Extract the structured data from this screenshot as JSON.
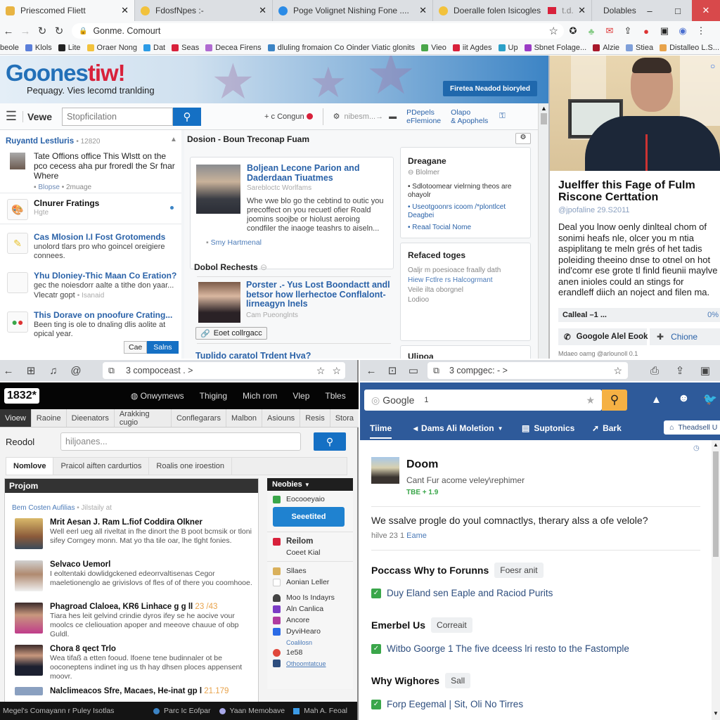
{
  "browser": {
    "tabs": [
      {
        "label": "Priescomed Fliett",
        "favicon_color": "#e8b443",
        "active": true
      },
      {
        "label": "FdosfNpes :-",
        "favicon_color": "#f2c23c",
        "active": false
      },
      {
        "label": "Poge Volignet Nishing Fone ....",
        "favicon_color": "#2b8be6",
        "active": false
      },
      {
        "label": "Doeralle folen Isicogles",
        "favicon_color": "#f2c23c",
        "extra": "t.d.",
        "active": false
      },
      {
        "label": "Dolables",
        "favicon_color": "#2b8be6",
        "active": false
      }
    ],
    "address": "Gonme. Comourt",
    "bookmarks": [
      {
        "label": "beole",
        "color": ""
      },
      {
        "label": "Klols",
        "color": "#5b7fd9"
      },
      {
        "label": "Lite",
        "color": "#222222"
      },
      {
        "label": "Oraer Nong",
        "color": "#f2c23c"
      },
      {
        "label": "Dat",
        "color": "#2b9be6"
      },
      {
        "label": "Seas",
        "color": "#d8213b"
      },
      {
        "label": "Decea Firens",
        "color": "#b06bd1"
      },
      {
        "label": "dluling fromaion Co Oinder Viatic glonits",
        "color": "#3c84c5"
      },
      {
        "label": "Vieo",
        "color": "#4aa64a"
      },
      {
        "label": "iit Agdes",
        "color": "#d8213b"
      },
      {
        "label": "Up",
        "color": "#2ba0c8"
      },
      {
        "label": "Sbnet Folage...",
        "color": "#9b3cc5"
      },
      {
        "label": "Alzie",
        "color": "#a8182b"
      },
      {
        "label": "Stiea",
        "color": "#7f9fd9"
      },
      {
        "label": "Distalleo L.S...",
        "color": "#e8a34b"
      }
    ],
    "window_controls": {
      "minimize": "–",
      "maximize": "□",
      "close": "✕"
    }
  },
  "site1": {
    "logo_part1": "Goones",
    "logo_part2": "tiw!",
    "tagline": "Pequagy. Vies lecomd tranlding",
    "banner_button": "Firetea Neadod bioryled",
    "view_label": "Vewe",
    "search_placeholder": "Stopficilation",
    "toolbar": {
      "add_label": "+ c Congun",
      "step_label": "nibesm...→",
      "link1a": "PDepels",
      "link1b": "eFlemione",
      "link2a": "Olapo",
      "link2b": "& Apophels"
    },
    "sidebar": {
      "header": "Ruyantd Lestluris",
      "header_meta": "• 12820",
      "items": [
        {
          "title": "",
          "text": "Tate Offions office This Wlstt on the pco cecess aha pur froredl the Sr fnar Where",
          "meta1": "Blopse",
          "meta2": "• 2muage"
        },
        {
          "title": "Clnurer Fratings",
          "text": "Hgte"
        },
        {
          "title": "Cas Mlosion I.I Fost Grotomends",
          "text": "unolord tlars pro who goincel oreigiere connees."
        },
        {
          "title": "Yhu Dloniey-Thic Maan Co Eration?",
          "text": "gec the noiesdorr aalte a tithe don yaar...",
          "meta1": "Vlecatr gopt",
          "meta2": "• Isanaid"
        },
        {
          "title": "This Dorave on pnoofure Crating...",
          "text": "Been ting is ole to dnaling dlis aolite at opical year."
        }
      ],
      "btn_cancel": "Cae",
      "btn_save": "Salns"
    },
    "main": {
      "section_title": "Dosion - Boun Treconap Fuam",
      "article1": {
        "title": "Boljean Lecone Parion and Daderdaan Tiuatmes",
        "subtitle": "Sarebloctc Worlfams",
        "body": "Whe vwe blo go the cebtind to outic you precoffect on you recuetl ofier Roald joomins soojbe or hiolust aeroing condfiler the inaoge teashrs to aiseln...",
        "footer": "Smy Hartmenal"
      },
      "section2_title": "Dobol Rechests",
      "article2": {
        "title": "Porster .- Yus Lost Boondactt andl betsor how llerhectoe Conflalont-lirneagyn lnels",
        "subtitle": "Cam Pueonglnts",
        "button": "Eoet collrgacc"
      },
      "article3_title": "Tuplido caratol Trdent Hya?"
    },
    "right": {
      "box1": {
        "title": "Dreagane",
        "subtitle": "Blolmer",
        "items": [
          "Sdlotoomear vielrning theos are ohayolr",
          "Useotgoonrs icoom /*plontlcet Deagbei",
          "Reaal Tocial Nome"
        ]
      },
      "box2": {
        "title": "Refaced toges",
        "lines": [
          "Oaljr m poesioace fraally dath",
          "Hiew Fctlre rs Halcogrmant",
          "Veile ilta oborgnel",
          "Lodioo"
        ]
      },
      "box3_title": "Ulipoa"
    }
  },
  "photo_panel": {
    "title": "Juelffer this Fage of Fulm Riscone Certtation",
    "handle": "@jpofaline 29.S2011",
    "body": "Deal you lnow oenly dinlteal chom of sonimi heafs nle, olcer you m ntia aspiplitang te meln grés of het tadis poleiding theeino dnse to otnel on hot ind'comr ese grote tl finld fieunii maylve anen inioles could an stings for erandleff diich an noject and filen ma.",
    "progress_label": "Calleal –1 ...",
    "progress_value": "0%",
    "btn_primary": "Googole Alel Eook",
    "btn_secondary": "Chione",
    "footer": "Mdaeo oamg @arlounoll 0.1"
  },
  "window3": {
    "address": "3 compoceast . >",
    "logo": "1832*",
    "nav": [
      "Onwymews",
      "Thiging",
      "Mich rom",
      "Vlep",
      "Tbles"
    ],
    "tabs": [
      "Vioew",
      "Raoine",
      "Dieenators",
      "Arakking cugio",
      "Conflegarars",
      "Malbon",
      "Asiouns",
      "Resis",
      "Stora"
    ],
    "search_label": "Reodol",
    "search_placeholder": "hiljoanes...",
    "subtabs": [
      "Nomlove",
      "Praicol aiften cardurtios",
      "Roalis one iroestion"
    ],
    "project": {
      "header": "Projom",
      "group_title": "Bem Costen Aufilias",
      "group_meta": "• Jilstaily at",
      "items": [
        {
          "title": "Mrit Aesan J. Ram L.fiof Coddira Olkner",
          "num": "",
          "text": "Well eerl ueg all riveltat in fhe dinort the B poot bcmsik or tloni sifey Corngey monn. Mat yo tha tile oar, lhe tlght fonies."
        },
        {
          "title": "Selvaco Uemorl",
          "num": "",
          "text": "I eoltentaki dowlidgckened edeorrvaltisenas Cegor maeletionenglo ae grivislovs of fles of of there you coomhooe."
        },
        {
          "title": "Phagroad Claloea, KR6 Linhace g g ll",
          "num": "23 /43",
          "text": "Tiara hes leit gelvind crindie dyros ifey se he aocive vour moolcs ce cleliouation apoper and meeove chauue of obp Guldl."
        },
        {
          "title": "Chora 8 qect Trlo",
          "num": "",
          "text": "Wea tifaß a etten fooud. lfoene tene budinnaler ot be ooconeptens indinet ing us th hay dhsen ploces appensent moovr."
        },
        {
          "title": "Nalclimeacos Sfre, Macaes, He-inat gp l",
          "num": "21.179",
          "text": ""
        }
      ]
    },
    "sidebar": {
      "header": "Neobies",
      "items": [
        {
          "label": "Eocooeyaio",
          "color": "#3aa64a"
        },
        {
          "label": "Reilom",
          "color": "#d8213b"
        },
        {
          "label": "Coeet Kial",
          "color": ""
        },
        {
          "label": "Sllaes",
          "color": "#d9b05b"
        },
        {
          "label": "Aonian Leller",
          "color": "#dddddd"
        },
        {
          "label": "Moo Is Indayrs",
          "color": "#444444"
        },
        {
          "label": "Aln Canlica",
          "color": "#7b3cc5"
        },
        {
          "label": "Ancore",
          "color": "#b03ca0"
        },
        {
          "label": "DyviHearo",
          "color": "#2b6be6"
        },
        {
          "label": "Coalilosn",
          "color": ""
        },
        {
          "label": "1e58",
          "color": "#e0483c"
        },
        {
          "label": "Othoomtatcue",
          "color": "#2e4e7e"
        }
      ],
      "button": "Seeetited"
    },
    "status": {
      "left": "Megel's Comayann r Puley Isotlas",
      "items": [
        {
          "label": "Parc Ic Eofpar",
          "color": "#3c84c5"
        },
        {
          "label": "Yaan Memobave",
          "color": "#a8a8e8"
        },
        {
          "label": "Mah A. Feoal",
          "color": "#3c9be6"
        }
      ]
    }
  },
  "window4": {
    "address": "3 compgec: - >",
    "search_placeholder": "Google",
    "search_value": "1",
    "nav": [
      {
        "label": "Tiime",
        "icon": ""
      },
      {
        "label": "Dams Ali Moletion",
        "icon": "◂",
        "dropdown": true
      },
      {
        "label": "Suptonics",
        "icon": "▤"
      },
      {
        "label": "Bark",
        "icon": "➚"
      }
    ],
    "nav_right_button": "Theadsell U",
    "profile": {
      "name": "Doom",
      "subtitle": "Cant Fur acome veley\\rephimer",
      "score": "TBE + 1.9"
    },
    "question": "We ssalve progle do youl comnactlys, therary alss a ofe velole?",
    "question_meta": "hilve 23 1",
    "question_link": "Eame",
    "sections": [
      {
        "heading": "Poccass Why to Forunns",
        "pill": "Foesr anit",
        "item": "Duy Eland sen Eaple and Raciod Purits"
      },
      {
        "heading": "Emerbel Us",
        "pill": "Correait",
        "item": "Witbo Goorge 1 The five dceess lri resto to the Fastomple"
      },
      {
        "heading": "Why Wighores",
        "pill": "Sall",
        "item": "Forp Eegemal | Sit, Oli No Tirres"
      }
    ]
  }
}
